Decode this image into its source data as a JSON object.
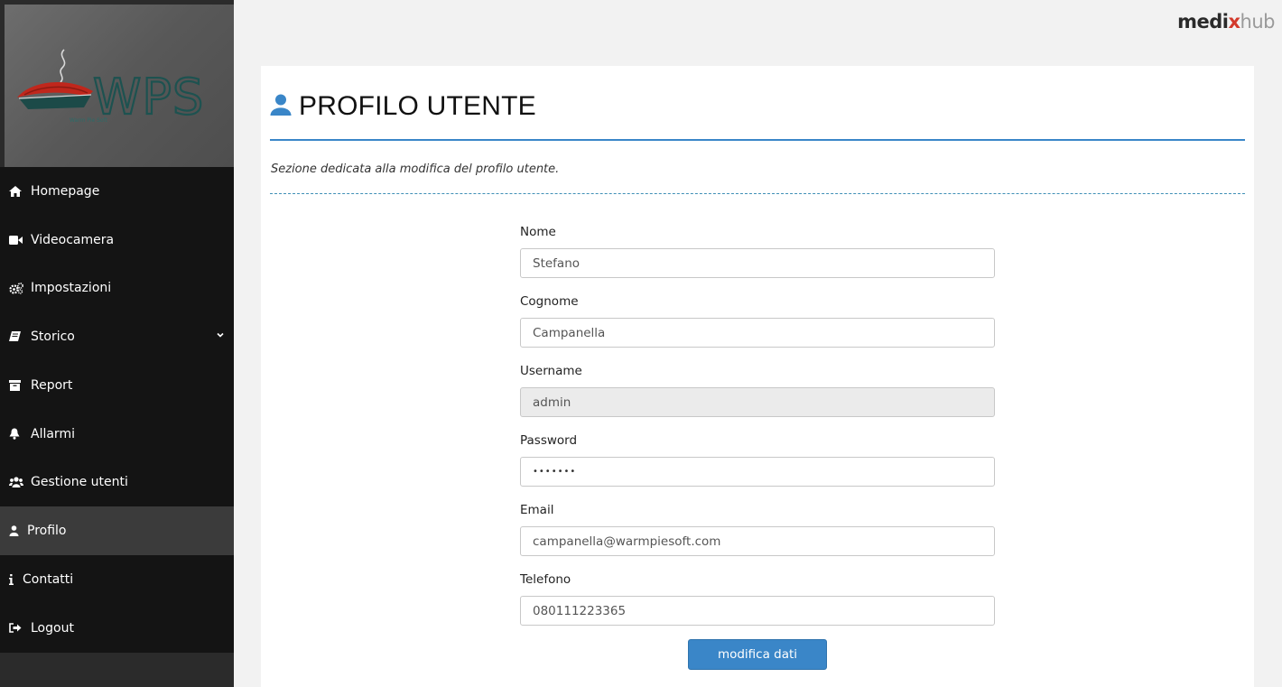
{
  "brand": {
    "part1": "medi",
    "part_x": "x",
    "part2": "hub"
  },
  "logo": {
    "text": "WPS"
  },
  "sidebar": {
    "items": [
      {
        "label": "Homepage",
        "icon": "home-icon"
      },
      {
        "label": "Videocamera",
        "icon": "video-camera-icon"
      },
      {
        "label": "Impostazioni",
        "icon": "gears-icon"
      },
      {
        "label": "Storico",
        "icon": "book-icon",
        "has_submenu": true
      },
      {
        "label": "Report",
        "icon": "archive-icon"
      },
      {
        "label": "Allarmi",
        "icon": "bell-icon"
      },
      {
        "label": "Gestione utenti",
        "icon": "users-icon"
      },
      {
        "label": "Profilo",
        "icon": "user-icon",
        "active": true
      },
      {
        "label": "Contatti",
        "icon": "info-icon"
      },
      {
        "label": "Logout",
        "icon": "sign-out-icon"
      }
    ]
  },
  "page": {
    "title": "PROFILO UTENTE",
    "description": "Sezione dedicata alla modifica del profilo utente."
  },
  "form": {
    "nome": {
      "label": "Nome",
      "value": "Stefano"
    },
    "cognome": {
      "label": "Cognome",
      "value": "Campanella"
    },
    "username": {
      "label": "Username",
      "value": "admin",
      "disabled": true
    },
    "password": {
      "label": "Password",
      "value": "•••••••"
    },
    "email": {
      "label": "Email",
      "value": "campanella@warmpiesoft.com"
    },
    "telefono": {
      "label": "Telefono",
      "value": "080111223365"
    },
    "submit_label": "modifica dati"
  },
  "colors": {
    "accent": "#3a86c8",
    "sidebar_bg": "#141414",
    "active_item_bg": "#3b3b3b",
    "brand_x": "#d33a2c"
  }
}
